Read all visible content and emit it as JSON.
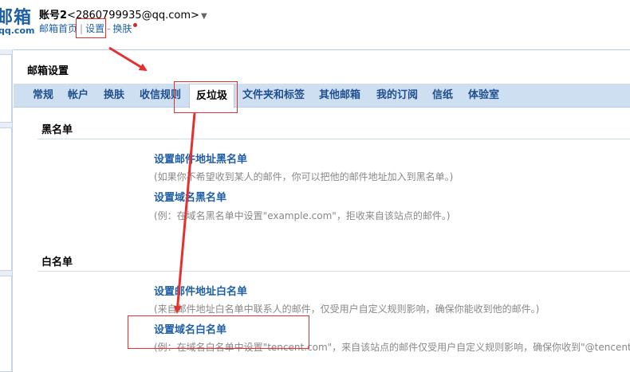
{
  "header": {
    "logo_text": "邮箱",
    "logo_sub": "qq.com",
    "account_name": "账号2",
    "account_email": "<2860799935@qq.com>",
    "links": {
      "home": "邮箱首页",
      "separator": "|",
      "settings": "设置",
      "dash": "-",
      "skin": "换肤"
    }
  },
  "main": {
    "title": "邮箱设置",
    "tabs": [
      {
        "label": "常规"
      },
      {
        "label": "帐户"
      },
      {
        "label": "换肤"
      },
      {
        "label": "收信规则"
      },
      {
        "label": "反垃圾"
      },
      {
        "label": "文件夹和标签"
      },
      {
        "label": "其他邮箱"
      },
      {
        "label": "我的订阅"
      },
      {
        "label": "信纸"
      },
      {
        "label": "体验室"
      }
    ],
    "active_tab": "反垃圾"
  },
  "blacklist": {
    "title": "黑名单",
    "address_link": "设置邮件地址黑名单",
    "address_desc": "(如果你不希望收到某人的邮件，你可以把他的邮件地址加入到黑名单。)",
    "domain_link": "设置域名黑名单",
    "domain_desc": "(例：在域名黑名单中设置\"example.com\"，拒收来自该站点的邮件。)"
  },
  "whitelist": {
    "title": "白名单",
    "address_link": "设置邮件地址白名单",
    "address_desc": "(来自邮件地址白名单中联系人的邮件，仅受用户自定义规则影响，确保你能收到他的邮件。)",
    "domain_link": "设置域名白名单",
    "domain_desc": "(例：在域名白名单中设置\"tencent.com\"，来自该站点的邮件仅受用户自定义规则影响，确保你收到\"@tencent.com\"发"
  },
  "colors": {
    "link": "#1f5fa8",
    "tabbar": "#cfdff2",
    "annotation": "#e53030"
  }
}
